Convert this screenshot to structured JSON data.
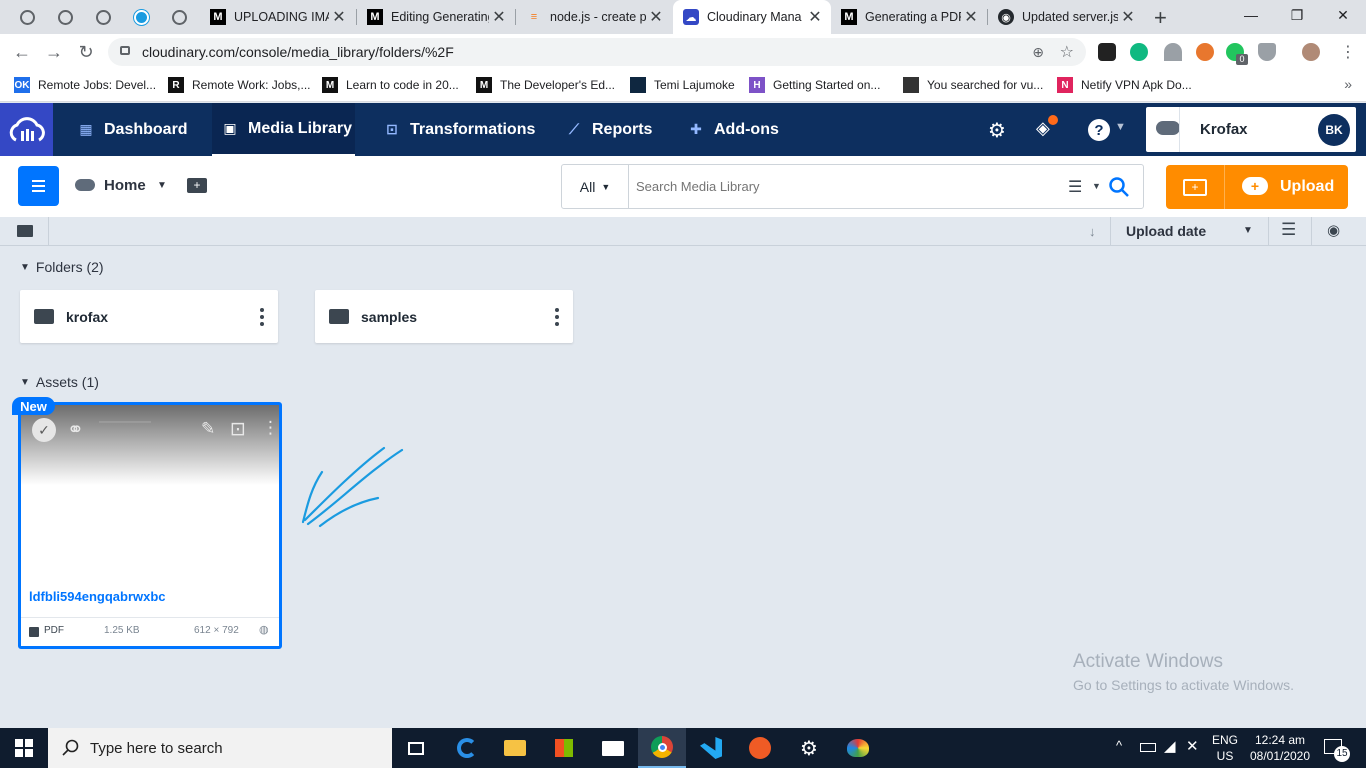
{
  "browser": {
    "tabs": [
      {
        "title": "UPLOADING IMAG"
      },
      {
        "title": "Editing Generating"
      },
      {
        "title": "node.js - create p"
      },
      {
        "title": "Cloudinary Mana"
      },
      {
        "title": "Generating a PDF"
      },
      {
        "title": "Updated server.js"
      }
    ],
    "url": "cloudinary.com/console/media_library/folders/%2F",
    "bookmarks": [
      {
        "label": "Remote Jobs: Devel...",
        "icon": "ok",
        "color": "#1f6feb"
      },
      {
        "label": "Remote Work: Jobs,...",
        "icon": "R",
        "color": "#111111"
      },
      {
        "label": "Learn to code in 20...",
        "icon": "M",
        "color": "#111111"
      },
      {
        "label": "The Developer's Ed...",
        "icon": "M",
        "color": "#111111"
      },
      {
        "label": "Temi Lajumoke",
        "icon": "",
        "color": "#0f2740"
      },
      {
        "label": "Getting Started on...",
        "icon": "H",
        "color": "#7d52c7"
      },
      {
        "label": "You searched for vu...",
        "icon": "",
        "color": "#333333"
      },
      {
        "label": "Netify VPN Apk Do...",
        "icon": "N",
        "color": "#e0245e"
      }
    ],
    "extension_badge": "0"
  },
  "cloudinary": {
    "nav": {
      "dashboard": "Dashboard",
      "media_library": "Media Library",
      "transformations": "Transformations",
      "reports": "Reports",
      "addons": "Add-ons"
    },
    "account": {
      "name": "Krofax",
      "initials": "BK"
    },
    "toolbar": {
      "home_label": "Home",
      "filter_value": "All",
      "search_placeholder": "Search Media Library",
      "upload_label": "Upload"
    },
    "sort": {
      "label": "Upload date"
    },
    "folders_section": {
      "label": "Folders (2)"
    },
    "folders": [
      {
        "name": "krofax"
      },
      {
        "name": "samples"
      }
    ],
    "assets_section": {
      "label": "Assets (1)"
    },
    "asset": {
      "badge": "New",
      "name": "ldfbli594engqabrwxbc",
      "format": "PDF",
      "size": "1.25 KB",
      "dimensions": "612 × 792"
    }
  },
  "watermark": {
    "title": "Activate Windows",
    "subtitle": "Go to Settings to activate Windows."
  },
  "taskbar": {
    "search_placeholder": "Type here to search",
    "lang_top": "ENG",
    "lang_bottom": "US",
    "time": "12:24 am",
    "date": "08/01/2020",
    "notifications": "15"
  },
  "colors": {
    "accent": "#0075ff",
    "nav_bg": "#0d2f5f",
    "upload": "#ff8c00",
    "annotation": "#1a9be0"
  }
}
